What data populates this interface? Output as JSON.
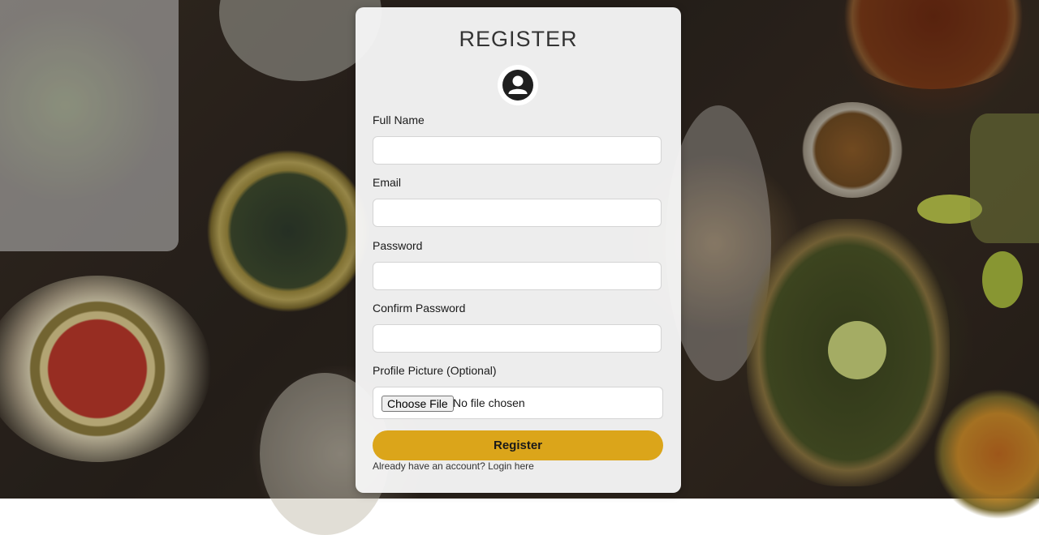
{
  "form": {
    "title": "REGISTER",
    "avatar_icon": "user-circle-icon",
    "fields": [
      {
        "label": "Full Name",
        "value": "",
        "placeholder": ""
      },
      {
        "label": "Email",
        "value": "",
        "placeholder": ""
      },
      {
        "label": "Password",
        "value": "",
        "placeholder": ""
      },
      {
        "label": "Confirm Password",
        "value": "",
        "placeholder": ""
      }
    ],
    "file_field": {
      "label": "Profile Picture (Optional)",
      "button_label": "Choose File",
      "status": "No file chosen"
    },
    "submit_label": "Register",
    "login_prompt": "Already have an account? Login here"
  },
  "colors": {
    "accent": "#dba51a",
    "card_bg": "#f6f6f6"
  }
}
